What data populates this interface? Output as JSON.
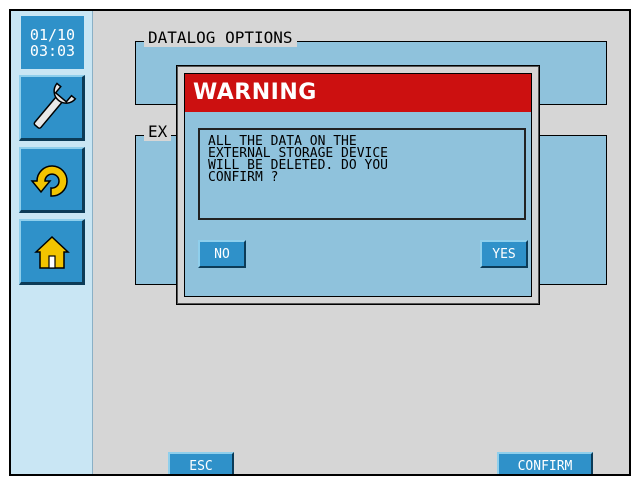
{
  "sidebar": {
    "clock": {
      "date": "01/10",
      "time": "03:03"
    },
    "buttons": [
      {
        "name": "wrench-icon"
      },
      {
        "name": "back-icon"
      },
      {
        "name": "home-icon"
      }
    ]
  },
  "main": {
    "datalog_group_title": "DATALOG OPTIONS",
    "second_group_title": "EX",
    "esc_label": "ESC",
    "confirm_label": "CONFIRM"
  },
  "dialog": {
    "title": "WARNING",
    "message": "ALL THE DATA ON THE\nEXTERNAL STORAGE DEVICE\nWILL BE DELETED. DO YOU\nCONFIRM ?",
    "no_label": "NO",
    "yes_label": "YES"
  },
  "colors": {
    "background": "#d6d6d6",
    "sidebar": "#c9e6f4",
    "button": "#2f91c9",
    "panel": "#8fc2dc",
    "warning": "#cc1010"
  }
}
